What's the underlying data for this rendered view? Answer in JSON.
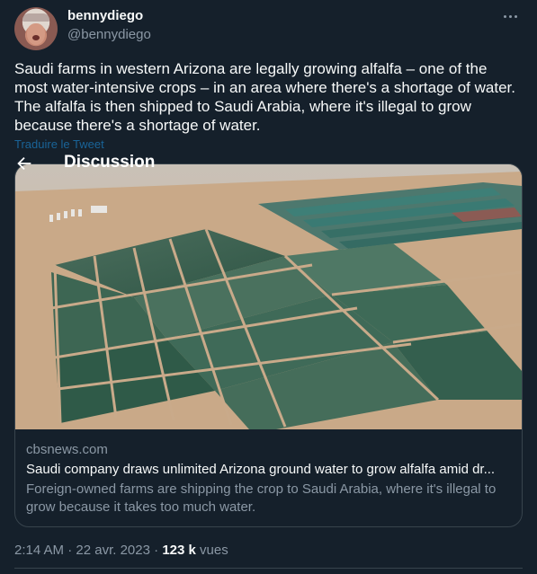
{
  "author": {
    "display_name": "bennydiego",
    "handle": "@bennydiego"
  },
  "tweet": {
    "text": "Saudi farms in western Arizona are legally growing alfalfa – one of the most water-intensive crops – in an area where there's a shortage of water. The alfalfa is then shipped to Saudi Arabia, where it's illegal to grow because there's a shortage of water.",
    "translate_label": "Traduire le Tweet"
  },
  "overlay": {
    "title": "Discussion"
  },
  "card": {
    "domain": "cbsnews.com",
    "title": "Saudi company draws unlimited Arizona ground water to grow alfalfa amid dr...",
    "description": "Foreign-owned farms are shipping the crop to Saudi Arabia, where it's illegal to grow because it takes too much water."
  },
  "meta": {
    "time": "2:14 AM",
    "separator": " · ",
    "date": "22 avr. 2023",
    "separator2": " · ",
    "views_count": "123 k",
    "views_label": " vues"
  },
  "icons": {
    "more": "more-dots-icon",
    "back": "arrow-left-icon"
  },
  "colors": {
    "background": "#15202b",
    "text": "#f7f9f9",
    "secondary": "#8b98a5",
    "link": "#1d9bf0",
    "border": "#38444d"
  }
}
